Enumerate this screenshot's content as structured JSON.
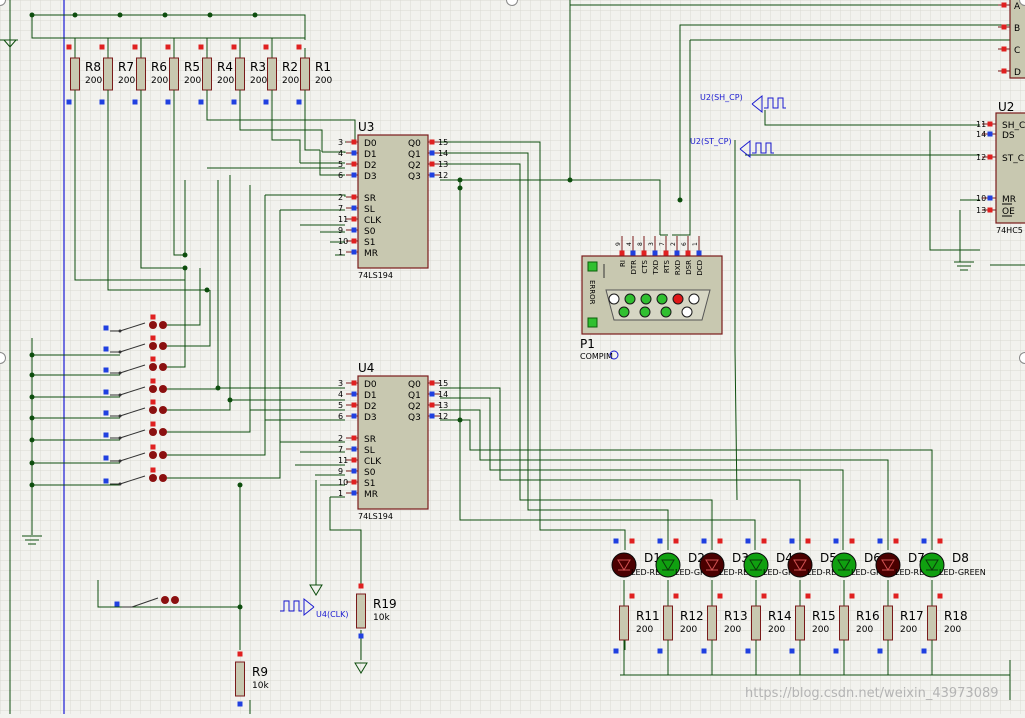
{
  "colors": {
    "background": "#f2f2ee",
    "grid": "#d9d9d3",
    "wire": "#0d4d0d",
    "chip_fill": "#c8c8b0",
    "chip_stroke": "#7a1a1a",
    "resistor_fill": "#c8c8b0",
    "pin_red": "#e02020",
    "pin_blue": "#2040e0",
    "probe_blue": "#1a1ad0",
    "led_red_off": "#4a0000",
    "led_green": "#10a010",
    "label": "#000000",
    "watermark": "#b4b4b4"
  },
  "resistors_top": [
    {
      "name": "R8",
      "value": "200"
    },
    {
      "name": "R7",
      "value": "200"
    },
    {
      "name": "R6",
      "value": "200"
    },
    {
      "name": "R5",
      "value": "200"
    },
    {
      "name": "R4",
      "value": "200"
    },
    {
      "name": "R3",
      "value": "200"
    },
    {
      "name": "R2",
      "value": "200"
    },
    {
      "name": "R1",
      "value": "200"
    }
  ],
  "chips": {
    "u3": {
      "designator": "U3",
      "part": "74LS194",
      "left_pins": [
        {
          "num": "3",
          "name": "D0"
        },
        {
          "num": "4",
          "name": "D1"
        },
        {
          "num": "5",
          "name": "D2"
        },
        {
          "num": "6",
          "name": "D3"
        },
        {
          "num": "2",
          "name": "SR"
        },
        {
          "num": "7",
          "name": "SL"
        },
        {
          "num": "11",
          "name": "CLK"
        },
        {
          "num": "9",
          "name": "S0"
        },
        {
          "num": "10",
          "name": "S1"
        },
        {
          "num": "1",
          "name": "MR"
        }
      ],
      "right_pins": [
        {
          "num": "15",
          "name": "Q0"
        },
        {
          "num": "14",
          "name": "Q1"
        },
        {
          "num": "13",
          "name": "Q2"
        },
        {
          "num": "12",
          "name": "Q3"
        }
      ]
    },
    "u4": {
      "designator": "U4",
      "part": "74LS194",
      "left_pins": [
        {
          "num": "3",
          "name": "D0"
        },
        {
          "num": "4",
          "name": "D1"
        },
        {
          "num": "5",
          "name": "D2"
        },
        {
          "num": "6",
          "name": "D3"
        },
        {
          "num": "2",
          "name": "SR"
        },
        {
          "num": "7",
          "name": "SL"
        },
        {
          "num": "11",
          "name": "CLK"
        },
        {
          "num": "9",
          "name": "S0"
        },
        {
          "num": "10",
          "name": "S1"
        },
        {
          "num": "1",
          "name": "MR"
        }
      ],
      "right_pins": [
        {
          "num": "15",
          "name": "Q0"
        },
        {
          "num": "14",
          "name": "Q1"
        },
        {
          "num": "13",
          "name": "Q2"
        },
        {
          "num": "12",
          "name": "Q3"
        }
      ]
    },
    "u2": {
      "designator": "U2",
      "part": "74HC5",
      "pins": [
        {
          "num": "11",
          "name": "SH_C"
        },
        {
          "num": "14",
          "name": "DS"
        },
        {
          "num": "12",
          "name": "ST_C"
        },
        {
          "num": "10",
          "name": "MR"
        },
        {
          "num": "13",
          "name": "OE"
        }
      ],
      "outputs": [
        "A",
        "B",
        "C",
        "D"
      ]
    }
  },
  "compim": {
    "designator": "P1",
    "part": "COMPIM",
    "error_label": "ERROR",
    "pin_labels": [
      "RI",
      "DTR",
      "CTS",
      "TXD",
      "RTS",
      "RXD",
      "DSR",
      "DCD"
    ],
    "pin_numbers": [
      "9",
      "4",
      "8",
      "3",
      "7",
      "2",
      "6",
      "1"
    ]
  },
  "clock_probes": [
    {
      "label": "U2(SH_CP)"
    },
    {
      "label": "U2(ST_CP)"
    },
    {
      "label": "U4(CLK)"
    }
  ],
  "leds": [
    {
      "name": "D1",
      "type": "LED-RED",
      "state": "off"
    },
    {
      "name": "D2",
      "type": "LED-GREEN",
      "state": "on"
    },
    {
      "name": "D3",
      "type": "LED-RED",
      "state": "off"
    },
    {
      "name": "D4",
      "type": "LED-GREEN",
      "state": "on"
    },
    {
      "name": "D5",
      "type": "LED-RED",
      "state": "off"
    },
    {
      "name": "D6",
      "type": "LED-GREEN",
      "state": "on"
    },
    {
      "name": "D7",
      "type": "LED-RED",
      "state": "off"
    },
    {
      "name": "D8",
      "type": "LED-GREEN",
      "state": "on"
    }
  ],
  "resistors_bottom": [
    {
      "name": "R11",
      "value": "200"
    },
    {
      "name": "R12",
      "value": "200"
    },
    {
      "name": "R13",
      "value": "200"
    },
    {
      "name": "R14",
      "value": "200"
    },
    {
      "name": "R15",
      "value": "200"
    },
    {
      "name": "R16",
      "value": "200"
    },
    {
      "name": "R17",
      "value": "200"
    },
    {
      "name": "R18",
      "value": "200"
    }
  ],
  "r19": {
    "name": "R19",
    "value": "10k"
  },
  "r9": {
    "name": "R9",
    "value": "10k"
  },
  "watermark": "https://blog.csdn.net/weixin_43973089"
}
